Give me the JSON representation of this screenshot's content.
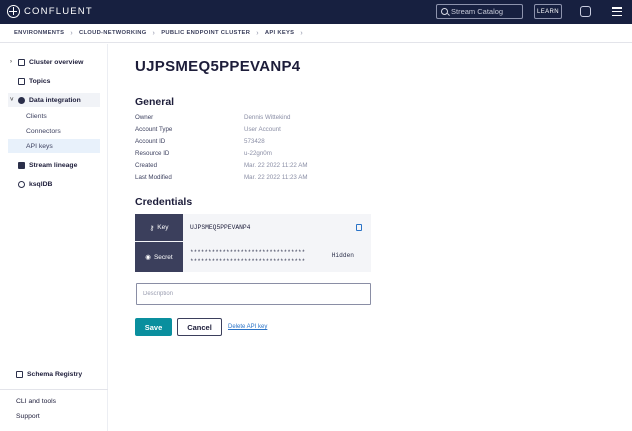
{
  "app": {
    "brand": "CONFLUENT",
    "search_placeholder": "Stream Catalog",
    "learn_label": "LEARN"
  },
  "breadcrumb": [
    "ENVIRONMENTS",
    "CLOUD-NETWORKING",
    "PUBLIC ENDPOINT CLUSTER",
    "API KEYS"
  ],
  "sidebar": {
    "items": [
      {
        "label": "Cluster overview",
        "icon": "grid-icon"
      },
      {
        "label": "Topics",
        "icon": "topics-icon"
      },
      {
        "label": "Data integration",
        "icon": "integration-icon"
      },
      {
        "label": "Clients"
      },
      {
        "label": "Connectors"
      },
      {
        "label": "API keys"
      },
      {
        "label": "Stream lineage",
        "icon": "lineage-icon"
      },
      {
        "label": "ksqlDB",
        "icon": "ksqldb-icon"
      }
    ],
    "bottom": [
      {
        "label": "Schema Registry",
        "icon": "schema-registry-icon"
      },
      {
        "label": "CLI and tools"
      },
      {
        "label": "Support"
      }
    ]
  },
  "page": {
    "title": "UJPSMEQ5PPEVANP4",
    "general_title": "General",
    "details": [
      {
        "key": "Owner",
        "value": "Dennis Wittekind"
      },
      {
        "key": "Account Type",
        "value": "User Account"
      },
      {
        "key": "Account ID",
        "value": "573428"
      },
      {
        "key": "Resource ID",
        "value": "u-22gn0m"
      },
      {
        "key": "Created",
        "value": "Mar. 22 2022 11:22 AM"
      },
      {
        "key": "Last Modified",
        "value": "Mar. 22 2022 11:23 AM"
      }
    ],
    "credentials_title": "Credentials",
    "credentials": {
      "key_label": "Key",
      "key_value": "UJPSMEQ5PPEVANP4",
      "secret_label": "Secret",
      "secret_mask_line1": "********************************",
      "secret_mask_line2": "********************************",
      "secret_state": "Hidden"
    },
    "description_placeholder": "Description",
    "save_label": "Save",
    "cancel_label": "Cancel",
    "delete_label": "Delete API key"
  },
  "colors": {
    "topbar": "#172040",
    "accent": "#0a8f9e",
    "cred_label_bg": "#3b3f5c",
    "link": "#2a73c7"
  }
}
